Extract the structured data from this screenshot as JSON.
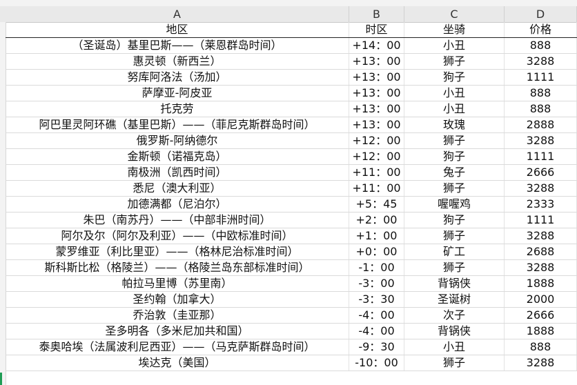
{
  "columns": [
    "A",
    "B",
    "C",
    "D"
  ],
  "header": {
    "region": "地区",
    "zone": "时区",
    "mount": "坐骑",
    "price": "价格"
  },
  "rows": [
    {
      "region": "（圣诞岛）基里巴斯——（莱恩群岛时间）",
      "zone": "+14：00",
      "mount": "小丑",
      "price": "888"
    },
    {
      "region": "惠灵顿（新西兰）",
      "zone": "+13：00",
      "mount": "狮子",
      "price": "3288"
    },
    {
      "region": "努库阿洛法（汤加）",
      "zone": "+13：00",
      "mount": "狗子",
      "price": "1111"
    },
    {
      "region": "萨摩亚-阿皮亚",
      "zone": "+13：00",
      "mount": "小丑",
      "price": "888"
    },
    {
      "region": "托克劳",
      "zone": "+13：00",
      "mount": "小丑",
      "price": "888"
    },
    {
      "region": "阿巴里灵阿环礁（基里巴斯）——（菲尼克斯群岛时间）",
      "zone": "+13：00",
      "mount": "玫瑰",
      "price": "2888"
    },
    {
      "region": "俄罗斯-阿纳德尔",
      "zone": "+12：00",
      "mount": "狮子",
      "price": "3288"
    },
    {
      "region": "金斯顿（诺福克岛）",
      "zone": "+12：00",
      "mount": "狗子",
      "price": "1111"
    },
    {
      "region": "南极洲（凯西时间）",
      "zone": "+11：00",
      "mount": "兔子",
      "price": "2666"
    },
    {
      "region": "悉尼（澳大利亚）",
      "zone": "+11：00",
      "mount": "狮子",
      "price": "3288"
    },
    {
      "region": "加德满都（尼泊尔）",
      "zone": "+5：45",
      "mount": "喔喔鸡",
      "price": "2333"
    },
    {
      "region": "朱巴（南苏丹）——（中部非洲时间）",
      "zone": "+2：00",
      "mount": "狗子",
      "price": "1111"
    },
    {
      "region": "阿尔及尔（阿尔及利亚）——（中欧标准时间）",
      "zone": "+1：00",
      "mount": "狮子",
      "price": "3288"
    },
    {
      "region": "蒙罗维亚（利比里亚）——（格林尼治标准时间）",
      "zone": "+0：00",
      "mount": "矿工",
      "price": "2688"
    },
    {
      "region": "斯科斯比松（格陵兰）——（格陵兰岛东部标准时间）",
      "zone": "-1：00",
      "mount": "狮子",
      "price": "3288"
    },
    {
      "region": "帕拉马里博（苏里南）",
      "zone": "-3：00",
      "mount": "背锅侠",
      "price": "1888"
    },
    {
      "region": "圣约翰（加拿大）",
      "zone": "-3：30",
      "mount": "圣诞树",
      "price": "2000"
    },
    {
      "region": "乔治敦（圭亚那）",
      "zone": "-4：00",
      "mount": "次子",
      "price": "2666"
    },
    {
      "region": "圣多明各（多米尼加共和国）",
      "zone": "-4：00",
      "mount": "背锅侠",
      "price": "1888"
    },
    {
      "region": "泰奥哈埃（法属波利尼西亚）——（马克萨斯群岛时间）",
      "zone": "-9：30",
      "mount": "小丑",
      "price": "888"
    },
    {
      "region": "埃达克（美国）",
      "zone": "-10：00",
      "mount": "狮子",
      "price": "3288"
    }
  ]
}
